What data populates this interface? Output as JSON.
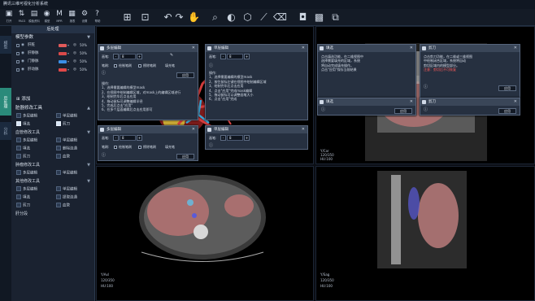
{
  "app": {
    "title": "腾讯三维可视化分析系统"
  },
  "toolbar": {
    "items": [
      {
        "name": "open-icon",
        "label": "打开",
        "glyph": "▣"
      },
      {
        "name": "dicom-icon",
        "label": "PACS",
        "glyph": "⇅"
      },
      {
        "name": "template-icon",
        "label": "模板资料",
        "glyph": "▤"
      },
      {
        "name": "model-icon",
        "label": "模型",
        "glyph": "◉"
      },
      {
        "name": "mpr-icon",
        "label": "MPR",
        "glyph": "M"
      },
      {
        "name": "print-icon",
        "label": "报表",
        "glyph": "▦"
      },
      {
        "name": "settings-icon",
        "label": "设置",
        "glyph": "⚙"
      },
      {
        "name": "help-icon",
        "label": "帮助",
        "glyph": "?"
      }
    ],
    "tools": [
      {
        "name": "layout-icon",
        "glyph": "⊞"
      },
      {
        "name": "crosshair-icon",
        "glyph": "⊡"
      },
      {
        "name": "undo-icon",
        "glyph": "↶"
      },
      {
        "name": "redo-icon",
        "glyph": "↷"
      },
      {
        "name": "pan-hand-icon",
        "glyph": "✋"
      },
      {
        "name": "zoom-icon",
        "glyph": "⌕"
      },
      {
        "name": "contrast-icon",
        "glyph": "◐"
      },
      {
        "name": "cube-icon",
        "glyph": "⬡"
      },
      {
        "name": "measure-icon",
        "glyph": "⟋"
      },
      {
        "name": "eraser-icon",
        "glyph": "⌫"
      },
      {
        "name": "camera-icon",
        "glyph": "◘"
      },
      {
        "name": "save-image-icon",
        "glyph": "▩"
      },
      {
        "name": "export-icon",
        "glyph": "⧉"
      }
    ]
  },
  "left_tabs": [
    "模型",
    "后处理",
    "分析"
  ],
  "panel": {
    "header": "后处理",
    "model_params": "模型参数",
    "models": [
      {
        "name": "肝脏",
        "color": "#e05a5a",
        "opacity": "50%"
      },
      {
        "name": "肝静脉",
        "color": "#d94a4a",
        "opacity": "50%"
      },
      {
        "name": "门静脉",
        "color": "#3b8fe6",
        "opacity": "50%"
      },
      {
        "name": "肝动脉",
        "color": "#e04848",
        "opacity": "50%"
      }
    ],
    "add_label": "添加",
    "edit_tools": "脏器修改工具",
    "edit_items": [
      "多层编辑",
      "单层编辑",
      "填选",
      "剪刀"
    ],
    "vessel_tools": "血管修改工具",
    "vessel_items": [
      "多层编辑",
      "单层编辑",
      "填选",
      "剪刀",
      "自动生长",
      "自动生长",
      "血管生长"
    ],
    "vessel_items_show": [
      "多层编辑",
      "单层编辑",
      "填选",
      "删除连通",
      "剪刀",
      "血管"
    ],
    "tumor_tools": "肿瘤修改工具",
    "tumor_items": [
      "多层编辑",
      "单层编辑"
    ],
    "other_tools": "其他修改工具",
    "other_items": [
      "多层编辑",
      "单层编辑",
      "填选",
      "提取连通",
      "剪刀",
      "血管"
    ],
    "liver_seg": "肝分段"
  },
  "views": {
    "coronal": {
      "tag1": "Y/Cor",
      "tag2": "120/350",
      "tag3": "HU:100"
    },
    "axial": {
      "tag1": "Y/Axl",
      "tag2": "120/350",
      "tag3": "HU:100"
    },
    "sagittal": {
      "tag1": "Y/Sag",
      "tag2": "120/350",
      "tag3": "HU:100"
    }
  },
  "dialogs": {
    "multi": {
      "title": "多层编辑",
      "size_label": "画笔:",
      "size_val": "8",
      "minus": "-",
      "plus": "+",
      "brush_label": "笔刷:",
      "draw": "绘制笔刷",
      "erase": "擦除笔刷",
      "fill": "填充笔",
      "help": "?",
      "apply": "应用",
      "desc": [
        "操作:",
        "1、选择需要编辑的模型mask",
        "2、在视图中绘制编辑区域，对mask上的编辑区域进行",
        "3、绘制完毕后点击应用",
        "4、拖动鼠标可调整编辑半径",
        "5、完成后点击\"应用\"",
        "6、在多个层面编辑后点击应用即可"
      ]
    },
    "single": {
      "title": "单层编辑",
      "size_label": "画笔:",
      "size_val": "8",
      "minus": "-",
      "plus": "+",
      "help": "?",
      "desc": [
        "操作:",
        "1、选择需要编辑的模型mask",
        "2、按住鼠标左键在视图中绘制编辑区域",
        "3、绘制完毕后点击应用",
        "4、点击\"应用\"完成mask编辑",
        "5、拖动鼠标可以调整画笔大小",
        "6、点击\"应用\"完成"
      ]
    },
    "multi2": {
      "title": "多层编辑",
      "size_label": "画笔:",
      "size_val": "8",
      "minus": "-",
      "plus": "+",
      "brush_label": "笔刷:",
      "draw": "绘制笔刷",
      "erase": "擦除笔刷",
      "fill": "填充笔",
      "help": "?",
      "apply": "应用"
    },
    "single2": {
      "title": "单层编辑",
      "size_label": "画笔:",
      "size_val": "8",
      "minus": "-",
      "plus": "+",
      "help": "?"
    },
    "fill": {
      "title": "填选",
      "help": "?",
      "apply": "应用",
      "desc": [
        "点击填选功能，在二维视图中",
        "选择需要填充的区域，系统",
        "将自动完成填充操作。",
        "点击\"应用\"保存当前结果"
      ]
    },
    "scissors": {
      "title": "剪刀",
      "help": "?",
      "apply": "应用",
      "desc": [
        "点击剪刀功能，在二维或三维视图",
        "中绘制闭合区域，系统将自动",
        "剪切区域内的模型部分。"
      ],
      "warn": "注意：剪切后不可恢复"
    },
    "fill2": {
      "title": "填选",
      "help": "?",
      "apply": "应用"
    },
    "scissors2": {
      "title": "剪刀",
      "help": "?",
      "apply": "应用"
    }
  }
}
